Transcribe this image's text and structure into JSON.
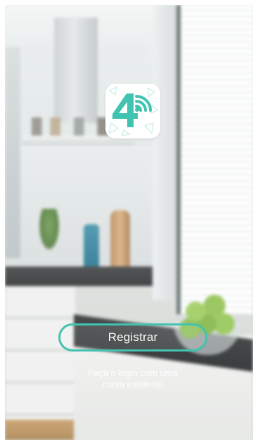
{
  "logo": {
    "icon": "app-logo-4g-wifi",
    "accent": "#40c3b0"
  },
  "actions": {
    "register_label": "Registrar",
    "login_line1": "Faça o login com uma",
    "login_line2": "conta existente"
  },
  "colors": {
    "button_border": "#40c3b0",
    "text": "#ffffff"
  }
}
